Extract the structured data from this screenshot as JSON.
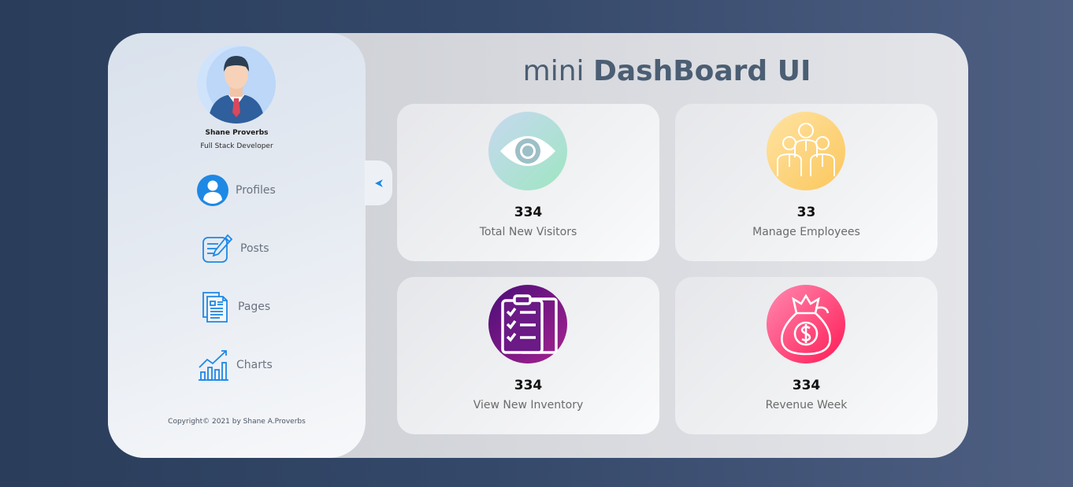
{
  "header": {
    "title_light": "mini",
    "title_bold": "DashBoard UI"
  },
  "profile": {
    "name": "Shane Proverbs",
    "role": "Full Stack Developer",
    "avatar_icon": "businessman-avatar-icon"
  },
  "sidebar": {
    "items": [
      {
        "label": "Profiles",
        "icon": "user-circle-icon"
      },
      {
        "label": "Posts",
        "icon": "edit-post-icon"
      },
      {
        "label": "Pages",
        "icon": "pages-document-icon"
      },
      {
        "label": "Charts",
        "icon": "bar-chart-trend-icon"
      }
    ],
    "toggle_icon": "collapse-arrow-icon",
    "copyright": "Copyright© 2021 by Shane A.Proverbs"
  },
  "cards": [
    {
      "value": "334",
      "label": "Total New Visitors",
      "icon": "eye-icon",
      "colors": [
        "#c7d8f0",
        "#9ee6c2"
      ]
    },
    {
      "value": "33",
      "label": "Manage Employees",
      "icon": "employees-group-icon",
      "colors": [
        "#ffe3a3",
        "#fbc75c"
      ]
    },
    {
      "value": "334",
      "label": "View New Inventory",
      "icon": "clipboard-checklist-icon",
      "colors": [
        "#4a0d78",
        "#a5238f"
      ]
    },
    {
      "value": "334",
      "label": "Revenue Week",
      "icon": "money-bag-icon",
      "colors": [
        "#ff8ab0",
        "#ff1a55"
      ]
    }
  ],
  "colors": {
    "accent": "#1e88e5",
    "title": "#4b5e73"
  }
}
